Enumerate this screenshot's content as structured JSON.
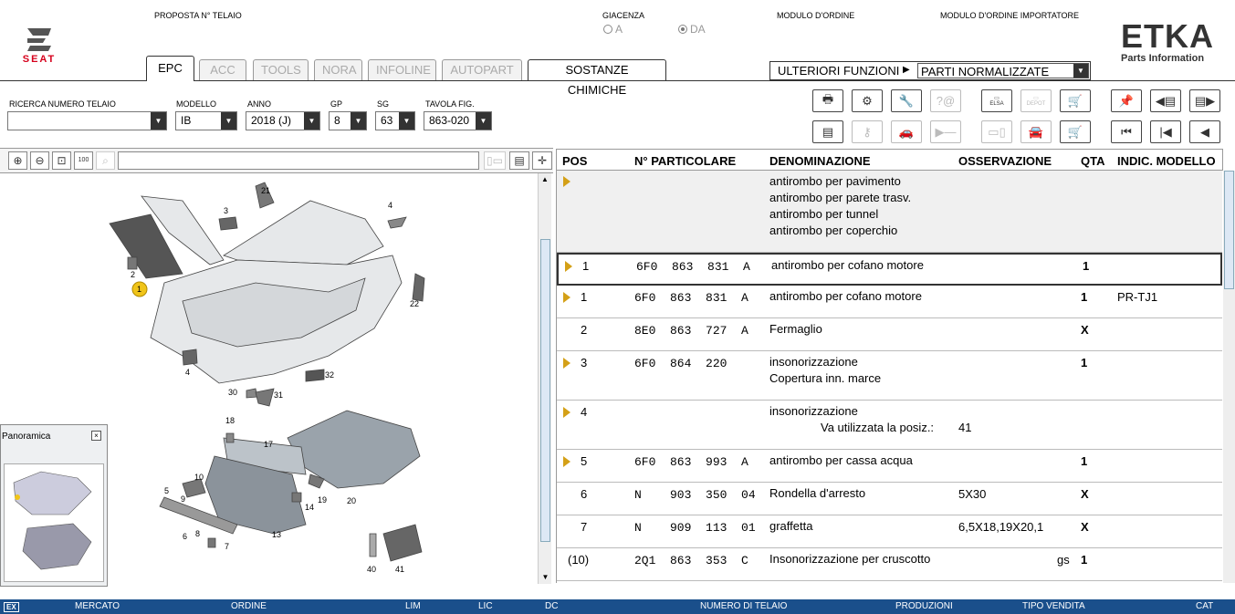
{
  "header": {
    "telaio_label": "PROPOSTA N° TELAIO",
    "giacenza_label": "GIACENZA",
    "radio_a": "A",
    "radio_da": "DA",
    "modulo_ordine": "MODULO D'ORDINE",
    "modulo_importatore": "MODULO D'ORDINE IMPORTATORE",
    "brand": "SEAT",
    "etka": "ETKA",
    "etka_sub": "Parts Information"
  },
  "tabs": [
    "EPC",
    "ACC",
    "TOOLS",
    "NORA",
    "INFOLINE",
    "AUTOPART",
    "SOSTANZE CHIMICHE"
  ],
  "functions": {
    "label": "ULTERIORI FUNZIONI",
    "value": "PARTI NORMALIZZATE"
  },
  "filters": {
    "ricerca_label": "RICERCA NUMERO TELAIO",
    "ricerca_value": "",
    "modello_label": "MODELLO",
    "modello_value": "IB",
    "anno_label": "ANNO",
    "anno_value": "2018 (J)",
    "gp_label": "GP",
    "gp_value": "8",
    "sg_label": "SG",
    "sg_value": "63",
    "tavola_label": "TAVOLA FIG.",
    "tavola_value": "863-020"
  },
  "toolbar": {
    "elsa": "ELSA",
    "depot": "DEPOT"
  },
  "panorama": {
    "title": "Panoramica"
  },
  "table": {
    "headers": [
      "POS",
      "N° PARTICOLARE",
      "DENOMINAZIONE",
      "OSSERVAZIONE",
      "QTA",
      "INDIC. MODELLO"
    ],
    "rows": [
      {
        "pos": "",
        "part": "",
        "desc": [
          "antirombo per pavimento",
          "antirombo per parete trasv.",
          "antirombo per tunnel",
          "antirombo per coperchio"
        ],
        "obs": "",
        "qta": "",
        "ind": "",
        "tri": true
      },
      {
        "pos": "1",
        "part": "6F0  863  831  A",
        "desc": [
          "antirombo per cofano motore"
        ],
        "obs": "",
        "qta": "1",
        "ind": "",
        "tri": true
      },
      {
        "pos": "1",
        "part": "6F0  863  831  A",
        "desc": [
          "antirombo per cofano motore"
        ],
        "obs": "",
        "qta": "1",
        "ind": "PR-TJ1",
        "tri": true
      },
      {
        "pos": "2",
        "part": "8E0  863  727  A",
        "desc": [
          "Fermaglio"
        ],
        "obs": "",
        "qta": "X",
        "ind": "",
        "tri": false
      },
      {
        "pos": "3",
        "part": "6F0  864  220",
        "desc": [
          "insonorizzazione",
          "Copertura inn. marce"
        ],
        "obs": "",
        "qta": "1",
        "ind": "",
        "tri": true
      },
      {
        "pos": "4",
        "part": "",
        "desc": [
          "insonorizzazione"
        ],
        "sub": "Va utilizzata la posiz.:",
        "subval": "41",
        "obs": "",
        "qta": "",
        "ind": "",
        "tri": true
      },
      {
        "pos": "5",
        "part": "6F0  863  993  A",
        "desc": [
          "antirombo per cassa acqua"
        ],
        "obs": "",
        "qta": "1",
        "ind": "",
        "tri": true
      },
      {
        "pos": "6",
        "part": "N    903  350  04",
        "desc": [
          "Rondella d'arresto"
        ],
        "obs": "5X30",
        "qta": "X",
        "ind": "",
        "tri": false
      },
      {
        "pos": "7",
        "part": "N    909  113  01",
        "desc": [
          "graffetta"
        ],
        "obs": "6,5X18,19X20,1",
        "qta": "X",
        "ind": "",
        "tri": false
      },
      {
        "pos": "(10)",
        "part": "2Q1  863  353  C",
        "desc": [
          "Insonorizzazione per cruscotto"
        ],
        "obs": "gs",
        "qta": "1",
        "ind": "",
        "tri": false
      }
    ]
  },
  "diagram_labels": [
    "21",
    "3",
    "4",
    "2",
    "1",
    "22",
    "4",
    "32",
    "30",
    "31",
    "18",
    "17",
    "10",
    "5",
    "9",
    "14",
    "19",
    "20",
    "6",
    "7",
    "13",
    "8",
    "40",
    "41"
  ],
  "status": {
    "ex": "EX",
    "mercato": "MERCATO",
    "ordine": "ORDINE",
    "lim": "LIM",
    "lic": "LIC",
    "dc": "DC",
    "numero": "NUMERO DI TELAIO",
    "produzioni": "PRODUZIONI",
    "tipo": "TIPO VENDITA",
    "cat": "CAT"
  }
}
